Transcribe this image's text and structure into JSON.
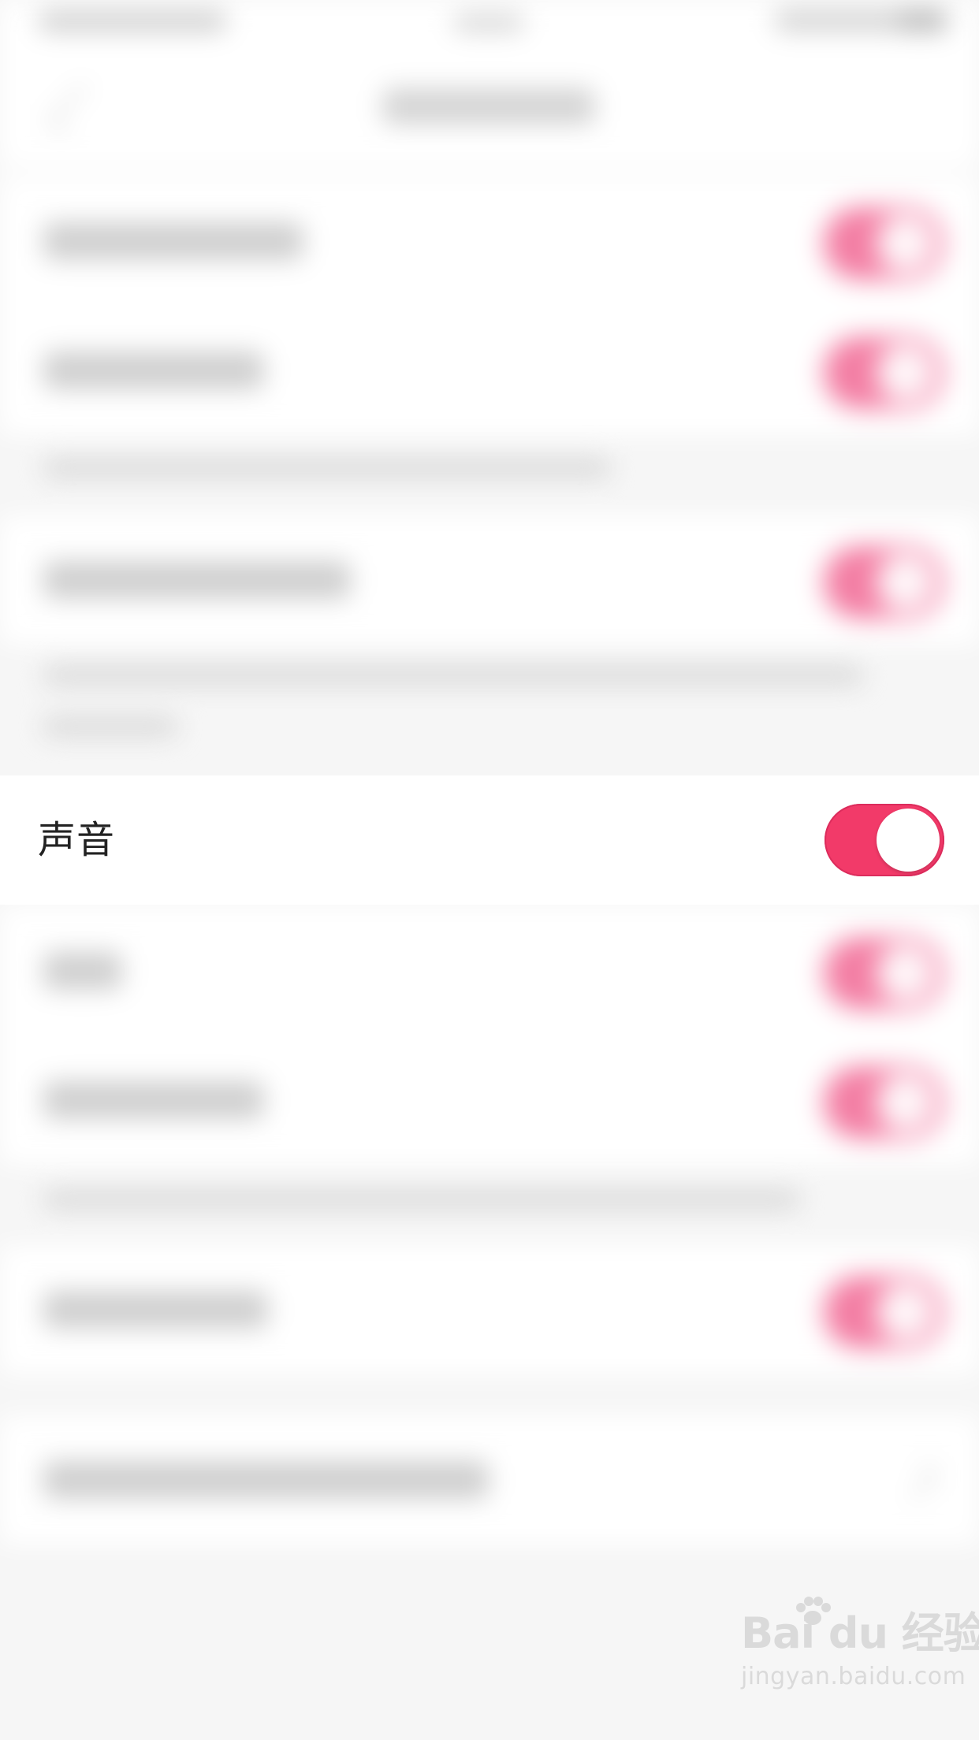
{
  "focused_row": {
    "label": "声音",
    "toggle_on": true
  },
  "watermark": {
    "logo": "Bai du 经验",
    "url": "jingyan.baidu.com"
  },
  "colors": {
    "toggle_active": "#f23a69",
    "toggle_blurred": "#f37da3",
    "background": "#f6f6f6",
    "surface": "#ffffff"
  }
}
